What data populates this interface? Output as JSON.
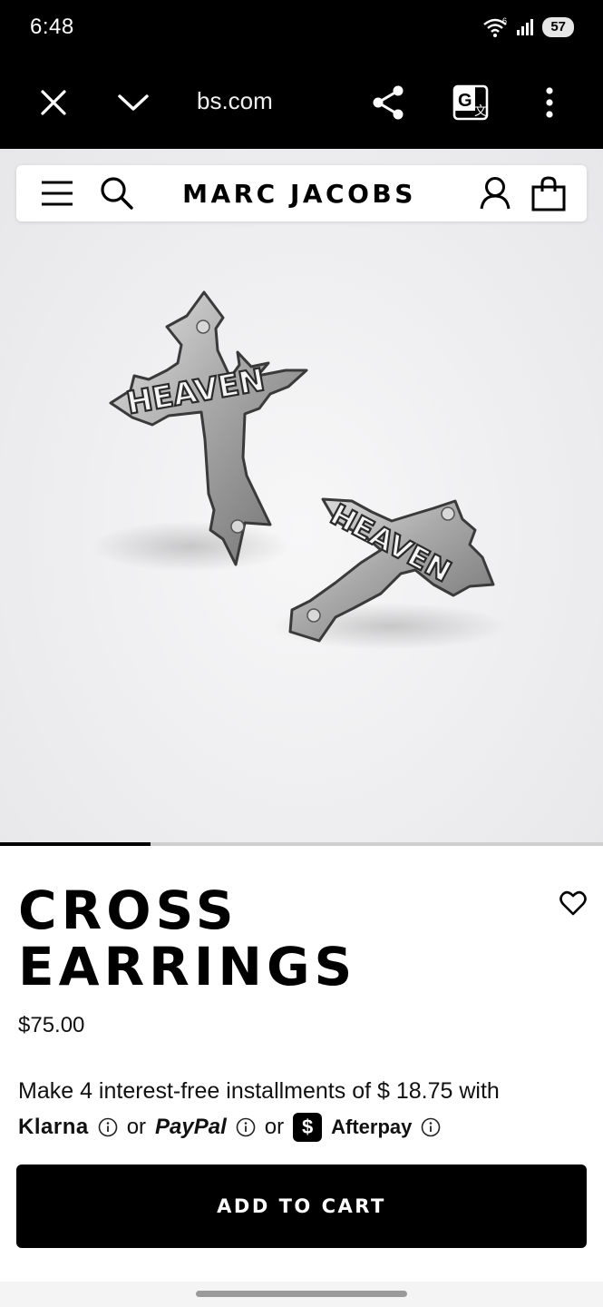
{
  "status_bar": {
    "time": "6:48",
    "battery": "57",
    "wifi_badge": "6"
  },
  "browser": {
    "url": "bs.com",
    "icons": [
      "close-icon",
      "chevron-down-icon",
      "share-icon",
      "translate-icon",
      "more-vert-icon"
    ]
  },
  "header": {
    "brand": "MARC JACOBS",
    "icons": [
      "menu-icon",
      "search-icon",
      "account-icon",
      "shopping-bag-icon"
    ]
  },
  "hero": {
    "engraving_left": "HEAVEN",
    "engraving_right": "HEAVEN",
    "carousel_progress": 0.25
  },
  "product": {
    "title_line1": "CROSS",
    "title_line2": "EARRINGS",
    "price": "$75.00"
  },
  "payment": {
    "installments_text": "Make 4 interest-free installments of $ 18.75 with",
    "klarna": "Klarna",
    "or_1": "or",
    "paypal": "PayPal",
    "or_2": "or",
    "afterpay_symbol": "$",
    "afterpay": "Afterpay"
  },
  "cta": {
    "add_to_cart": "ADD TO CART"
  }
}
